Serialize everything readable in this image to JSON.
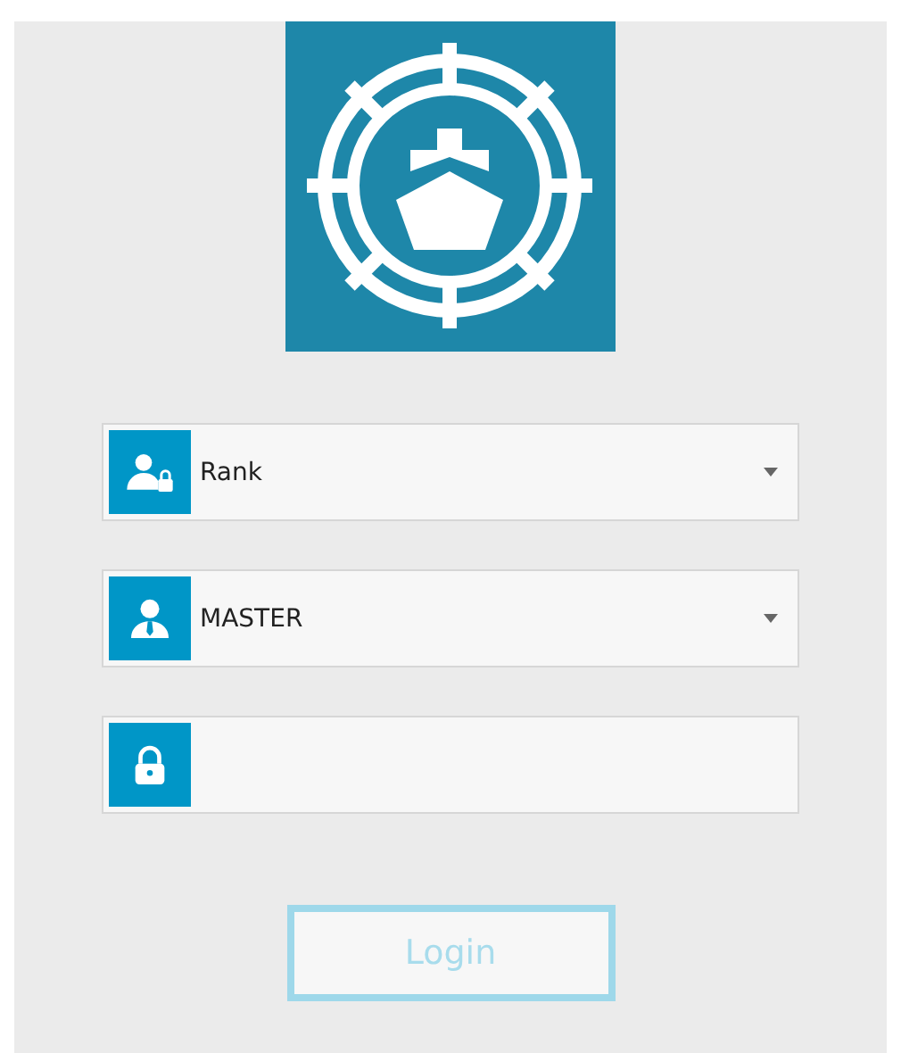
{
  "fields": [
    {
      "kind": "dropdown",
      "value": "Rank"
    },
    {
      "kind": "dropdown",
      "value": "MASTER"
    },
    {
      "kind": "password"
    }
  ],
  "login_button": {
    "label": "Login",
    "disabled": true
  }
}
